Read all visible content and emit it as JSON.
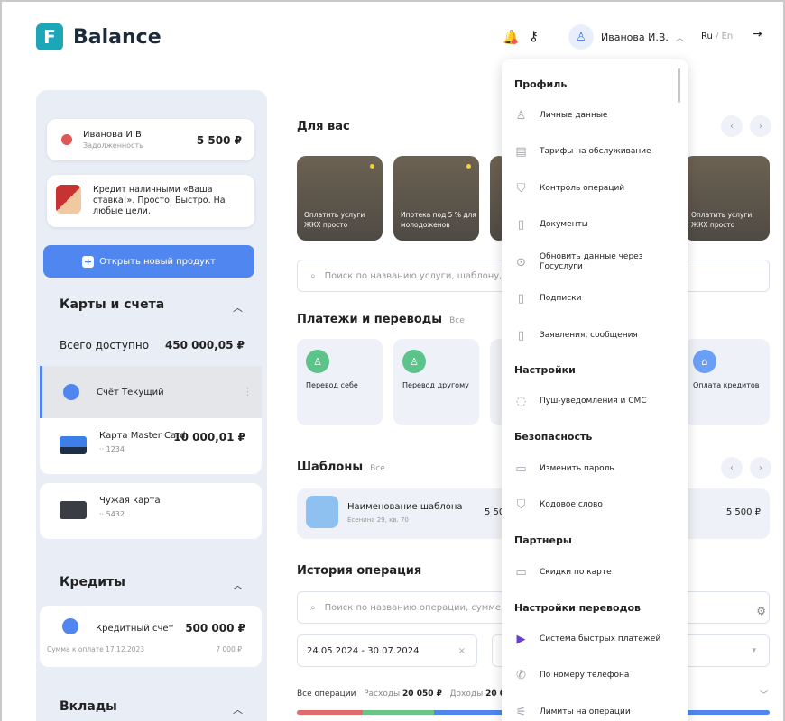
{
  "header": {
    "logo_letter": "F",
    "logo_text": "Balance",
    "user_name": "Иванова И.В.",
    "lang_active": "Ru",
    "lang_sep": " / ",
    "lang_other": "En"
  },
  "sidebar": {
    "debt": {
      "name": "Иванова И.В.",
      "label": "Задолженность",
      "amount": "5 500 ₽"
    },
    "promo": {
      "text": "Кредит наличными «Ваша ставка!». Просто. Быстро. На любые цели."
    },
    "new_product_label": "Открыть новый продукт",
    "accounts_title": "Карты и счета",
    "total_label": "Всего доступно",
    "total_amount": "450 000,05 ₽",
    "accounts": [
      {
        "name": "Счёт Текущий"
      },
      {
        "name": "Карта Master Card",
        "number": "·· 1234",
        "amount": "10 000,01 ₽"
      },
      {
        "name": "Чужая карта",
        "number": "·· 5432"
      }
    ],
    "credits_title": "Кредиты",
    "credit": {
      "name": "Кредитный счет",
      "amount": "500 000 ₽",
      "due": "Сумма к оплате 17.12.2023",
      "due_amount": "7 000 ₽"
    },
    "deposits_title": "Вклады"
  },
  "main": {
    "for_you_title": "Для вас",
    "tiles": [
      {
        "caption": "Оплатить услуги ЖКХ просто"
      },
      {
        "caption": "Ипотека под 5 % для молодоженов"
      },
      {
        "caption": "Оплатить услуги ЖКХ просто"
      }
    ],
    "search_placeholder": "Поиск по названию услуги, шаблону, ИН",
    "payments_title": "Платежи и переводы",
    "all_label": "Все",
    "payments": [
      {
        "label": "Перевод себе",
        "color": "#5cc48a"
      },
      {
        "label": "Перевод другому",
        "color": "#5cc48a"
      },
      {
        "label": "Оплата кредитов",
        "color": "#6b9ef5"
      }
    ],
    "templates_title": "Шаблоны",
    "template": {
      "name": "Наименование шаблона",
      "address": "Есенина 29, кв. 70",
      "amount_cut": "5 50",
      "amount": "5 500 ₽"
    },
    "history_title": "История операция",
    "history_search_placeholder": "Поиск по названию операции, сумме, да",
    "date_range": "24.05.2024 - 30.07.2024",
    "ops_all": "Все операции",
    "ops_expense_label": "Расходы",
    "ops_expense": "20 050 ₽",
    "ops_income_label": "Доходы",
    "ops_income": "20 0",
    "bar": [
      {
        "share": 0.14,
        "color": "#e36a6a"
      },
      {
        "share": 0.15,
        "color": "#6cc486"
      },
      {
        "share": 0.71,
        "color": "#4f86f0"
      }
    ]
  },
  "menu": {
    "profile_title": "Профиль",
    "profile_items": [
      "Личные данные",
      "Тарифы на обслуживание",
      "Контроль операций",
      "Документы",
      "Обновить данные через Госуслуги",
      "Подписки",
      "Заявления, сообщения"
    ],
    "settings_title": "Настройки",
    "settings_items": [
      "Пуш-уведомления и СМС"
    ],
    "security_title": "Безопасность",
    "security_items": [
      "Изменить пароль",
      "Кодовое слово"
    ],
    "partners_title": "Партнеры",
    "partners_items": [
      "Скидки по карте"
    ],
    "transfer_title": "Настройки переводов",
    "transfer_items": [
      "Система быстрых платежей",
      "По номеру телефона",
      "Лимиты на операции"
    ]
  }
}
